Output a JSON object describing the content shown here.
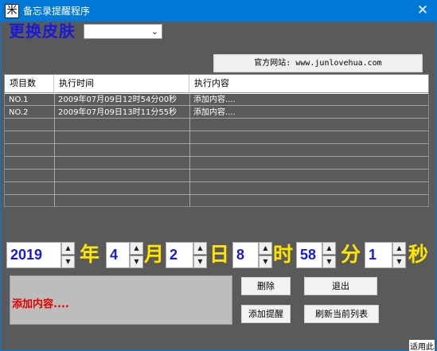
{
  "window": {
    "title": "备忘录提醒程序",
    "close_glyph": "✕",
    "icon_glyph": "米"
  },
  "skin": {
    "label": "更换皮肤",
    "selected": ""
  },
  "site_button": "官方网站: www.junlovehua.com",
  "grid": {
    "columns": [
      "项目数",
      "执行时间",
      "执行内容"
    ],
    "rows": [
      [
        "NO.1",
        "2009年07月09日12时54分00秒",
        "添加内容...."
      ],
      [
        "NO.2",
        "2009年07月09日13时11分55秒",
        "添加内容...."
      ]
    ]
  },
  "datetime": {
    "year": "2019",
    "year_unit": "年",
    "month": "4",
    "month_unit": "月",
    "day": "2",
    "day_unit": "日",
    "hour": "8",
    "hour_unit": "时",
    "minute": "58",
    "minute_unit": "分",
    "second": "1",
    "second_unit": "秒"
  },
  "content_preview": "添加内容....",
  "buttons": {
    "delete": "删除",
    "exit": "退出",
    "add_reminder": "添加提醒",
    "refresh_list": "刷新当前列表"
  },
  "status": "适用此",
  "colors": {
    "titlebar": "#0078d7",
    "background": "#5a5a5a",
    "accent_blue": "#1a1ad6",
    "unit_yellow": "#ffe600",
    "content_red": "#e00000"
  },
  "icons": [
    "app-icon",
    "close-icon",
    "chevron-down-icon",
    "spin-up-icon",
    "spin-down-icon"
  ]
}
